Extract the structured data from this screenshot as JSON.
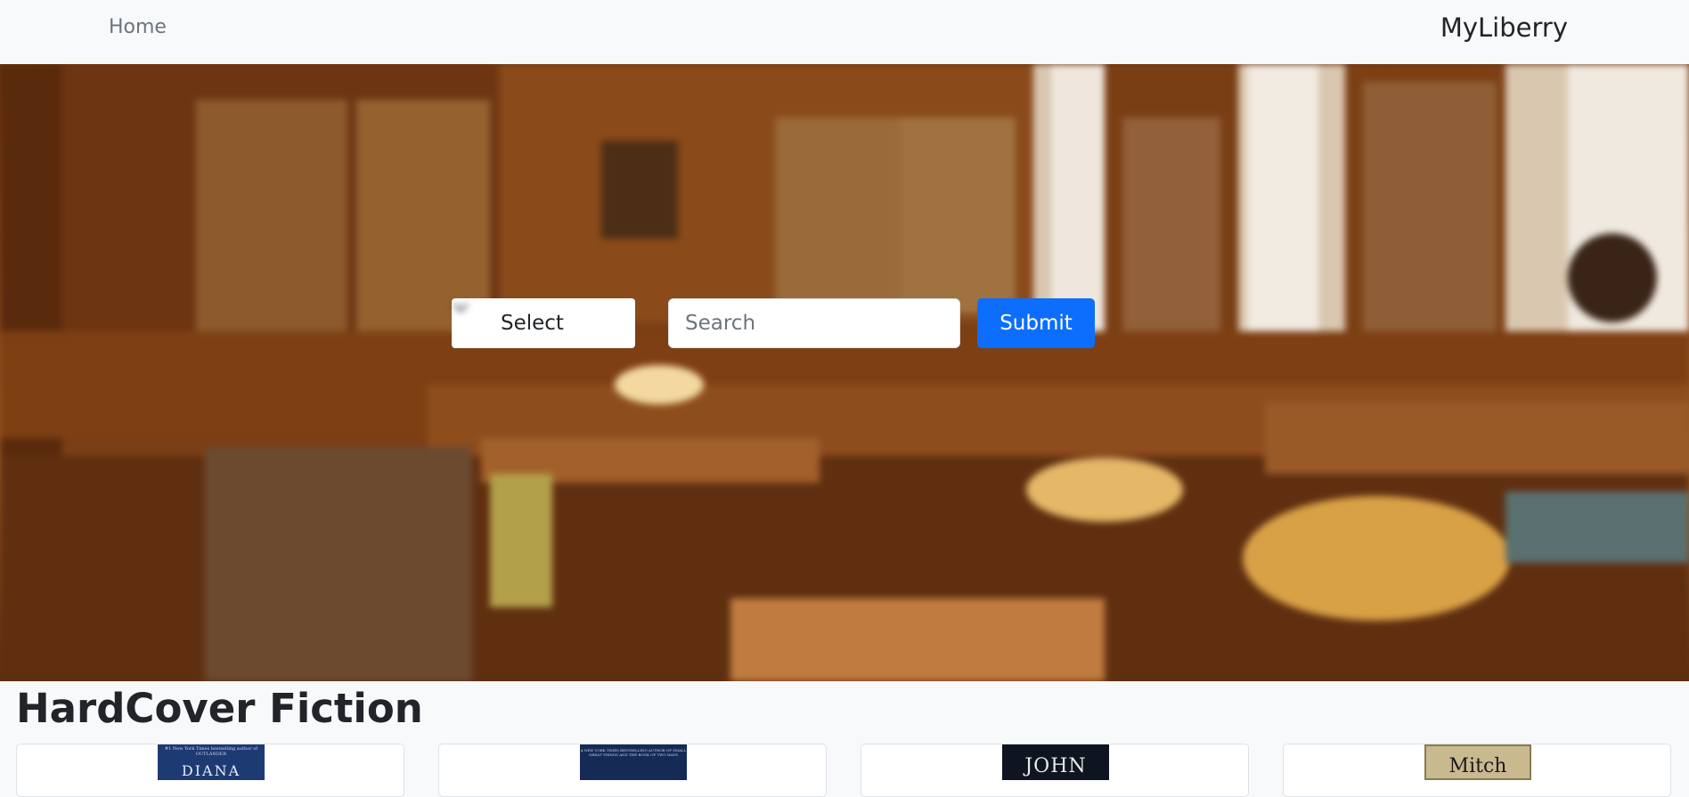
{
  "nav": {
    "home_label": "Home",
    "brand": "MyLiberry"
  },
  "search": {
    "select_label": "Select",
    "placeholder": "Search",
    "submit_label": "Submit"
  },
  "colors": {
    "primary": "#0d6efd",
    "navbar_bg": "#f8f9fa"
  },
  "section": {
    "title": "HardCover Fiction"
  },
  "books": [
    {
      "cover_tagline": "#1 New York Times bestselling author of OUTLANDER",
      "cover_title": "DIANA",
      "cover_color": "#1d3a73"
    },
    {
      "cover_tagline": "A NEW YORK TIMES BESTSELLING AUTHOR OF SMALL GREAT THINGS AND THE BOOK OF TWO WAYS",
      "cover_title": "",
      "cover_color": "#152a55"
    },
    {
      "cover_tagline": "",
      "cover_title": "JOHN",
      "cover_color": "#0e1520"
    },
    {
      "cover_tagline": "",
      "cover_title": "Mitch",
      "cover_color": "#c9b98f"
    }
  ]
}
